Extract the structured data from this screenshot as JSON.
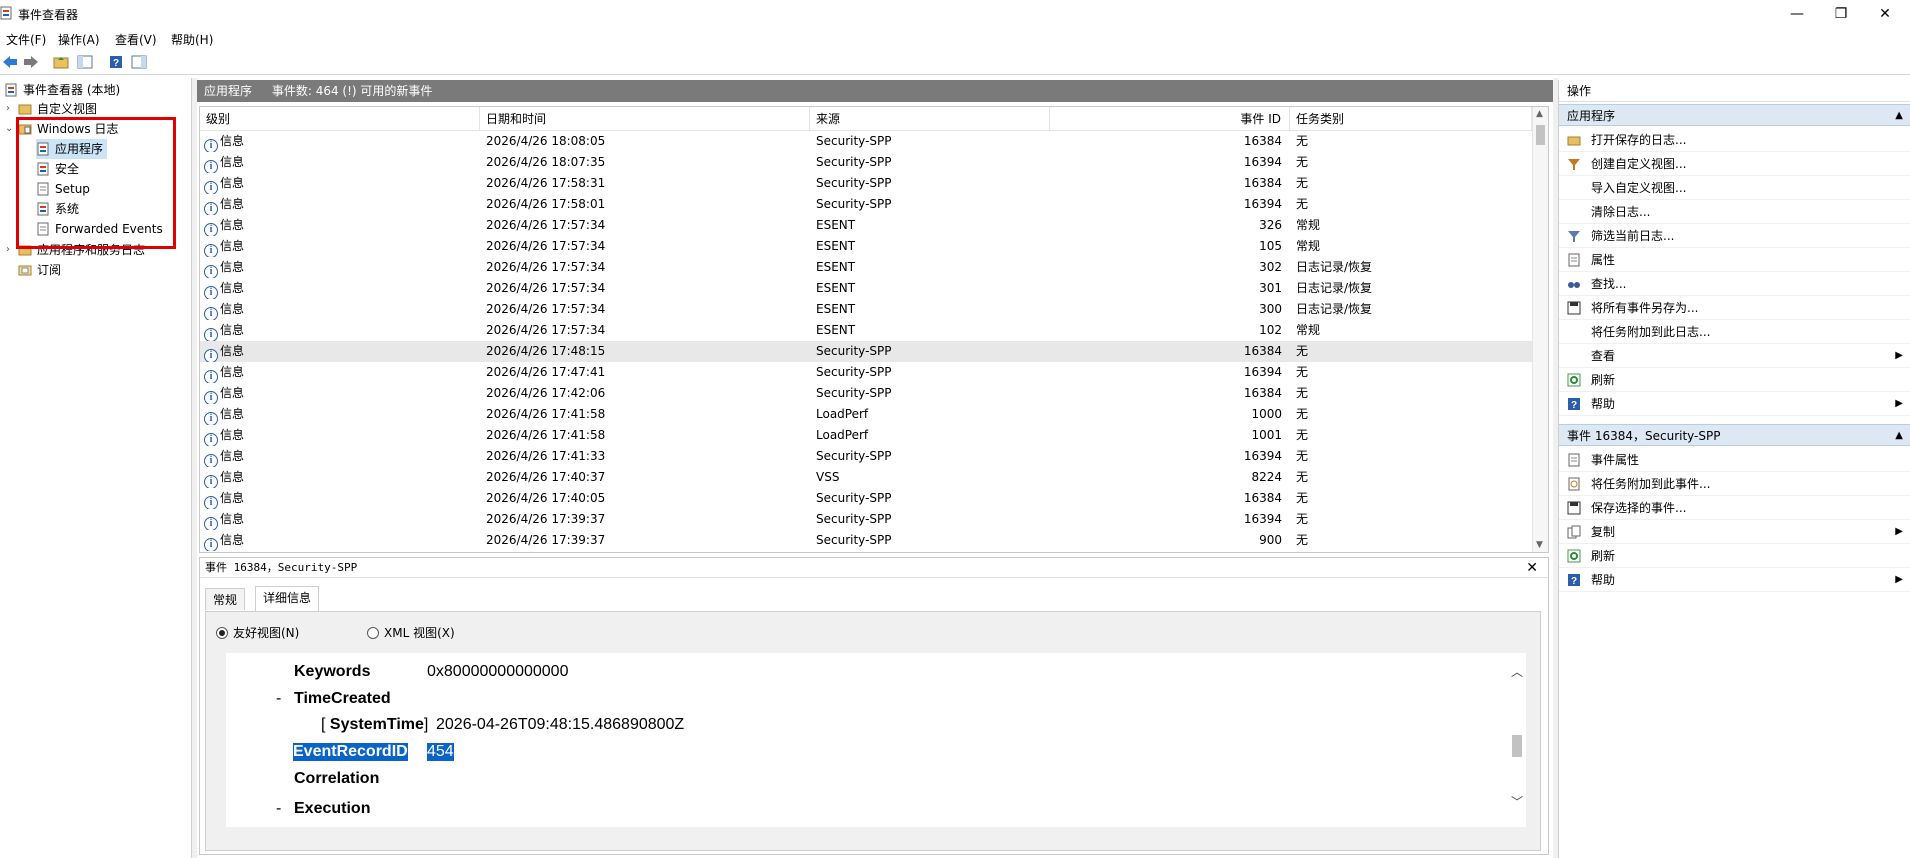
{
  "window": {
    "title": "事件查看器",
    "minimize": "—",
    "restore": "❐",
    "close": "✕"
  },
  "menu": [
    "文件(F)",
    "操作(A)",
    "查看(V)",
    "帮助(H)"
  ],
  "tree": {
    "root": "事件查看器 (本地)",
    "custom_views": "自定义视图",
    "windows_logs": "Windows 日志",
    "logs": [
      "应用程序",
      "安全",
      "Setup",
      "系统",
      "Forwarded Events"
    ],
    "app_services": "应用程序和服务日志",
    "subscriptions": "订阅"
  },
  "middle_header": {
    "log_name": "应用程序",
    "count_text": "事件数: 464 (!) 可用的新事件"
  },
  "grid": {
    "columns": [
      "级别",
      "日期和时间",
      "来源",
      "事件 ID",
      "任务类别"
    ],
    "rows": [
      {
        "level": "信息",
        "datetime": "2026/4/26 18:08:05",
        "source": "Security-SPP",
        "id": "16384",
        "task": "无"
      },
      {
        "level": "信息",
        "datetime": "2026/4/26 18:07:35",
        "source": "Security-SPP",
        "id": "16394",
        "task": "无"
      },
      {
        "level": "信息",
        "datetime": "2026/4/26 17:58:31",
        "source": "Security-SPP",
        "id": "16384",
        "task": "无"
      },
      {
        "level": "信息",
        "datetime": "2026/4/26 17:58:01",
        "source": "Security-SPP",
        "id": "16394",
        "task": "无"
      },
      {
        "level": "信息",
        "datetime": "2026/4/26 17:57:34",
        "source": "ESENT",
        "id": "326",
        "task": "常规"
      },
      {
        "level": "信息",
        "datetime": "2026/4/26 17:57:34",
        "source": "ESENT",
        "id": "105",
        "task": "常规"
      },
      {
        "level": "信息",
        "datetime": "2026/4/26 17:57:34",
        "source": "ESENT",
        "id": "302",
        "task": "日志记录/恢复"
      },
      {
        "level": "信息",
        "datetime": "2026/4/26 17:57:34",
        "source": "ESENT",
        "id": "301",
        "task": "日志记录/恢复"
      },
      {
        "level": "信息",
        "datetime": "2026/4/26 17:57:34",
        "source": "ESENT",
        "id": "300",
        "task": "日志记录/恢复"
      },
      {
        "level": "信息",
        "datetime": "2026/4/26 17:57:34",
        "source": "ESENT",
        "id": "102",
        "task": "常规"
      },
      {
        "level": "信息",
        "datetime": "2026/4/26 17:48:15",
        "source": "Security-SPP",
        "id": "16384",
        "task": "无"
      },
      {
        "level": "信息",
        "datetime": "2026/4/26 17:47:41",
        "source": "Security-SPP",
        "id": "16394",
        "task": "无"
      },
      {
        "level": "信息",
        "datetime": "2026/4/26 17:42:06",
        "source": "Security-SPP",
        "id": "16384",
        "task": "无"
      },
      {
        "level": "信息",
        "datetime": "2026/4/26 17:41:58",
        "source": "LoadPerf",
        "id": "1000",
        "task": "无"
      },
      {
        "level": "信息",
        "datetime": "2026/4/26 17:41:58",
        "source": "LoadPerf",
        "id": "1001",
        "task": "无"
      },
      {
        "level": "信息",
        "datetime": "2026/4/26 17:41:33",
        "source": "Security-SPP",
        "id": "16394",
        "task": "无"
      },
      {
        "level": "信息",
        "datetime": "2026/4/26 17:40:37",
        "source": "VSS",
        "id": "8224",
        "task": "无"
      },
      {
        "level": "信息",
        "datetime": "2026/4/26 17:40:05",
        "source": "Security-SPP",
        "id": "16384",
        "task": "无"
      },
      {
        "level": "信息",
        "datetime": "2026/4/26 17:39:37",
        "source": "Security-SPP",
        "id": "16394",
        "task": "无"
      },
      {
        "level": "信息",
        "datetime": "2026/4/26 17:39:37",
        "source": "Security-SPP",
        "id": "900",
        "task": "无"
      }
    ]
  },
  "detail": {
    "header": "事件 16384，Security-SPP",
    "tabs": [
      "常规",
      "详细信息"
    ],
    "radio_friendly": "友好视图(N)",
    "radio_xml": "XML 视图(X)",
    "xml": {
      "keywords_label": "Keywords",
      "keywords_value": "0x80000000000000",
      "dash": "-",
      "timecreated": "TimeCreated",
      "systemtime_open": "[",
      "systemtime_label": "SystemTime",
      "systemtime_close": "]",
      "systemtime_value": "2026-04-26T09:48:15.486890800Z",
      "recordid_label": "EventRecordID",
      "recordid_value": "454",
      "correlation": "Correlation",
      "execution": "Execution"
    }
  },
  "actions": {
    "title": "操作",
    "section1": "应用程序",
    "section1_items": [
      "打开保存的日志...",
      "创建自定义视图...",
      "导入自定义视图...",
      "清除日志...",
      "筛选当前日志...",
      "属性",
      "查找...",
      "将所有事件另存为...",
      "将任务附加到此日志...",
      "查看",
      "刷新",
      "帮助"
    ],
    "section2": "事件 16384，Security-SPP",
    "section2_items": [
      "事件属性",
      "将任务附加到此事件...",
      "保存选择的事件...",
      "复制",
      "刷新",
      "帮助"
    ]
  }
}
